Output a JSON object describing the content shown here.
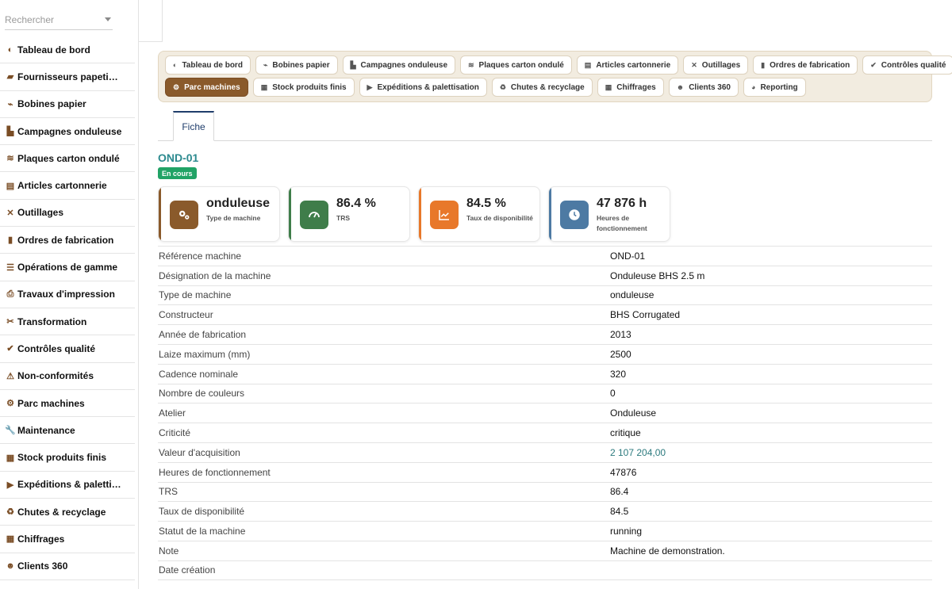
{
  "search": {
    "placeholder": "Rechercher"
  },
  "sidebar": {
    "items": [
      {
        "label": "Tableau de bord",
        "icon": "gauge-icon",
        "glyph": "◐"
      },
      {
        "label": "Fournisseurs papeti…",
        "icon": "truck-icon",
        "glyph": "▰"
      },
      {
        "label": "Bobines papier",
        "icon": "scroll-icon",
        "glyph": "⌁"
      },
      {
        "label": "Campagnes onduleuse",
        "icon": "industry-icon",
        "glyph": "▙"
      },
      {
        "label": "Plaques carton ondulé",
        "icon": "layers-icon",
        "glyph": "≋"
      },
      {
        "label": "Articles cartonnerie",
        "icon": "box-icon",
        "glyph": "▤"
      },
      {
        "label": "Outillages",
        "icon": "tools-icon",
        "glyph": "✕"
      },
      {
        "label": "Ordres de fabrication",
        "icon": "clipboard-icon",
        "glyph": "▮"
      },
      {
        "label": "Opérations de gamme",
        "icon": "list-icon",
        "glyph": "☰"
      },
      {
        "label": "Travaux d'impression",
        "icon": "print-icon",
        "glyph": "⎙"
      },
      {
        "label": "Transformation",
        "icon": "scissors-icon",
        "glyph": "✂"
      },
      {
        "label": "Contrôles qualité",
        "icon": "check-circle-icon",
        "glyph": "✔"
      },
      {
        "label": "Non-conformités",
        "icon": "warning-icon",
        "glyph": "⚠"
      },
      {
        "label": "Parc machines",
        "icon": "cogs-icon",
        "glyph": "⚙"
      },
      {
        "label": "Maintenance",
        "icon": "wrench-icon",
        "glyph": "🔧"
      },
      {
        "label": "Stock produits finis",
        "icon": "warehouse-icon",
        "glyph": "▦"
      },
      {
        "label": "Expéditions & paletti…",
        "icon": "shipping-truck-icon",
        "glyph": "▶"
      },
      {
        "label": "Chutes & recyclage",
        "icon": "recycle-icon",
        "glyph": "♻"
      },
      {
        "label": "Chiffrages",
        "icon": "calculator-icon",
        "glyph": "▦"
      },
      {
        "label": "Clients 360",
        "icon": "users-icon",
        "glyph": "☻"
      }
    ]
  },
  "modules": {
    "row1": [
      {
        "label": "Tableau de bord",
        "icon": "gauge-icon",
        "glyph": "◐"
      },
      {
        "label": "Bobines papier",
        "icon": "scroll-icon",
        "glyph": "⌁"
      },
      {
        "label": "Campagnes onduleuse",
        "icon": "industry-icon",
        "glyph": "▙"
      },
      {
        "label": "Plaques carton ondulé",
        "icon": "layers-icon",
        "glyph": "≋"
      },
      {
        "label": "Articles cartonnerie",
        "icon": "box-icon",
        "glyph": "▤"
      },
      {
        "label": "Outillages",
        "icon": "tools-icon",
        "glyph": "✕"
      },
      {
        "label": "Ordres de fabrication",
        "icon": "clipboard-icon",
        "glyph": "▮"
      },
      {
        "label": "Contrôles qualité",
        "icon": "check-circle-icon",
        "glyph": "✔"
      }
    ],
    "row2": [
      {
        "label": "Parc machines",
        "icon": "cogs-icon",
        "glyph": "⚙",
        "active": true
      },
      {
        "label": "Stock produits finis",
        "icon": "warehouse-icon",
        "glyph": "▦"
      },
      {
        "label": "Expéditions & palettisation",
        "icon": "shipping-truck-icon",
        "glyph": "▶"
      },
      {
        "label": "Chutes & recyclage",
        "icon": "recycle-icon",
        "glyph": "♻"
      },
      {
        "label": "Chiffrages",
        "icon": "calculator-icon",
        "glyph": "▦"
      },
      {
        "label": "Clients 360",
        "icon": "users-icon",
        "glyph": "☻"
      },
      {
        "label": "Reporting",
        "icon": "chart-pie-icon",
        "glyph": "◕"
      }
    ]
  },
  "subtabs": {
    "active": "Fiche"
  },
  "record": {
    "title": "OND-01",
    "status": "En cours",
    "status_color": "#21a366"
  },
  "kpis": [
    {
      "value": "onduleuse",
      "label": "Type de machine",
      "icon": "cogs-icon",
      "color": "#8a5a2b"
    },
    {
      "value": "86.4 %",
      "label": "TRS",
      "icon": "gauge-icon",
      "color": "#3f7d4a"
    },
    {
      "value": "84.5 %",
      "label": "Taux de disponibilité",
      "icon": "chart-line-icon",
      "color": "#e8782a"
    },
    {
      "value": "47 876 h",
      "label": "Heures de fonctionnement",
      "icon": "clock-icon",
      "color": "#4d7aa3"
    }
  ],
  "details": [
    {
      "key": "Référence machine",
      "value": "OND-01"
    },
    {
      "key": "Désignation de la machine",
      "value": "Onduleuse BHS 2.5 m"
    },
    {
      "key": "Type de machine",
      "value": "onduleuse"
    },
    {
      "key": "Constructeur",
      "value": "BHS Corrugated"
    },
    {
      "key": "Année de fabrication",
      "value": "2013"
    },
    {
      "key": "Laize maximum (mm)",
      "value": "2500"
    },
    {
      "key": "Cadence nominale",
      "value": "320"
    },
    {
      "key": "Nombre de couleurs",
      "value": "0"
    },
    {
      "key": "Atelier",
      "value": "Onduleuse"
    },
    {
      "key": "Criticité",
      "value": "critique"
    },
    {
      "key": "Valeur d'acquisition",
      "value": "2 107 204,00",
      "link": true
    },
    {
      "key": "Heures de fonctionnement",
      "value": "47876"
    },
    {
      "key": "TRS",
      "value": "86.4"
    },
    {
      "key": "Taux de disponibilité",
      "value": "84.5"
    },
    {
      "key": "Statut de la machine",
      "value": "running"
    },
    {
      "key": "Note",
      "value": "Machine de demonstration."
    },
    {
      "key": "Date création",
      "value": ""
    }
  ]
}
